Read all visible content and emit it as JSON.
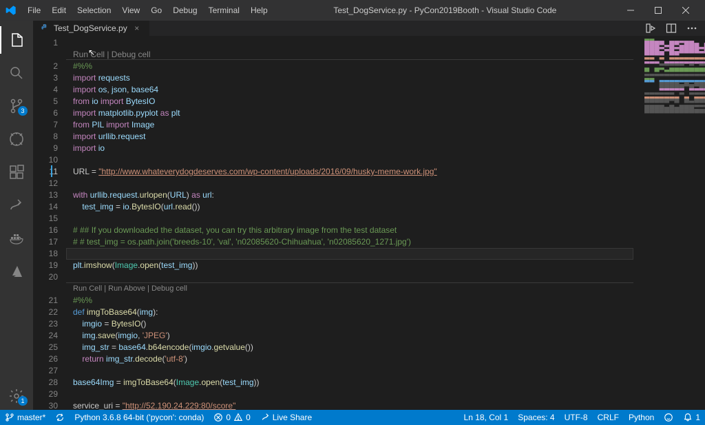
{
  "title": "Test_DogService.py - PyCon2019Booth - Visual Studio Code",
  "menu": [
    "File",
    "Edit",
    "Selection",
    "View",
    "Go",
    "Debug",
    "Terminal",
    "Help"
  ],
  "tab": {
    "label": "Test_DogService.py"
  },
  "cell1_lens": "Run Cell | Debug cell",
  "cell2_lens": "Run Cell | Run Above | Debug cell",
  "lines": {
    "l1": "",
    "l2": "#%%",
    "l21": "#%%"
  },
  "code": {
    "url_assign_prefix": "URL = ",
    "url_value": "\"http://www.whateverydogdeserves.com/wp-content/uploads/2016/09/husky-meme-work.jpg\"",
    "cmt16": "# ## If you downloaded the dataset, you can try this arbitrary image from the test dataset",
    "cmt17": "# # test_img = os.path.join('breeds-10', 'val', 'n02085620-Chihuahua', 'n02085620_1271.jpg')",
    "svc_prefix": "service_uri = ",
    "svc_value": "\"http://52.190.24.229:80/score\""
  },
  "status": {
    "branch": "master*",
    "python": "Python 3.6.8 64-bit ('pycon': conda)",
    "problems_err": "0",
    "problems_warn": "0",
    "liveshare": "Live Share",
    "lncol": "Ln 18, Col 1",
    "spaces": "Spaces: 4",
    "encoding": "UTF-8",
    "eol": "CRLF",
    "lang": "Python",
    "notif": "1"
  },
  "badges": {
    "scm": "3",
    "gear": "1"
  }
}
